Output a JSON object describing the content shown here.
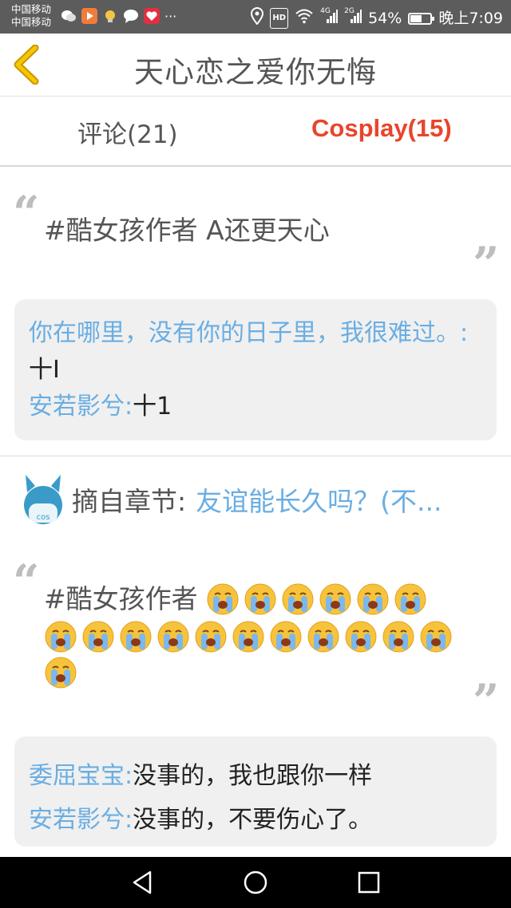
{
  "status_bar": {
    "carrier_1": "中国移动",
    "carrier_2": "中国移动",
    "more": "···",
    "network_1": "4G",
    "network_2": "2G",
    "battery": "54%",
    "time": "晚上7:09",
    "hd": "HD"
  },
  "header": {
    "title": "天心恋之爱你无悔"
  },
  "tabs": [
    {
      "label": "评论(21)",
      "active": false
    },
    {
      "label": "Cosplay(15)",
      "active": true
    }
  ],
  "post1": {
    "text": "#酷女孩作者 A还更天心",
    "replies": [
      {
        "name": "你在哪里，没有你的日子里，我很难过。:",
        "text": "十I"
      },
      {
        "name": "安若影兮:",
        "text": "十1"
      }
    ]
  },
  "post2": {
    "chapter_label": "摘自章节:",
    "chapter_link": "友谊能长久吗？(不...",
    "avatar_text": "cos",
    "text": "#酷女孩作者",
    "emoji_count": 18,
    "replies": [
      {
        "name": "委屈宝宝:",
        "text": "没事的，我也跟你一样"
      },
      {
        "name": "安若影兮:",
        "text": "没事的，不要伤心了。"
      }
    ]
  },
  "colors": {
    "accent": "#e8452c",
    "link": "#6aaee2",
    "statusbar": "#5c5c5c"
  },
  "icons": [
    "back-arrow-icon",
    "cosplay-avatar-icon",
    "nav-back-icon",
    "nav-home-icon",
    "nav-recents-icon"
  ]
}
